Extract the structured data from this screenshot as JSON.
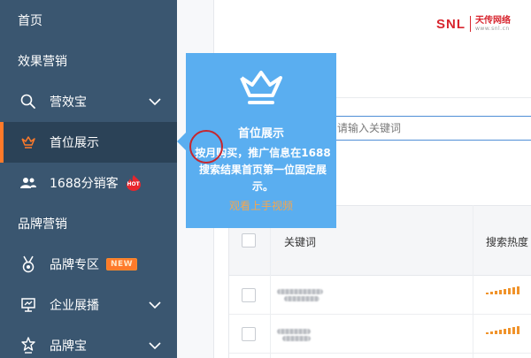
{
  "sidebar": {
    "home": "首页",
    "section_effect": "效果营销",
    "yingxiaobao": "营效宝",
    "shouwei": "首位展示",
    "fenxiaoke": "1688分销客",
    "hot_badge": "HOT",
    "section_brand": "品牌营销",
    "brand_zone": "品牌专区",
    "new_badge": "NEW",
    "enterprise": "企业展播",
    "brand_treasure": "品牌宝",
    "accent_color": "#ff7a2a"
  },
  "logo": {
    "brand": "SNL",
    "cn_name": "天传网络",
    "url": "www.snl.cn"
  },
  "search": {
    "placeholder": "请输入关键词"
  },
  "table": {
    "headers": {
      "keyword": "关键词",
      "heat": "搜索热度"
    }
  },
  "popover": {
    "title": "首位展示",
    "description": "按月购买，推广信息在1688搜索结果首页第一位固定展示。",
    "link": "观看上手视频",
    "icon": "crown-icon"
  }
}
